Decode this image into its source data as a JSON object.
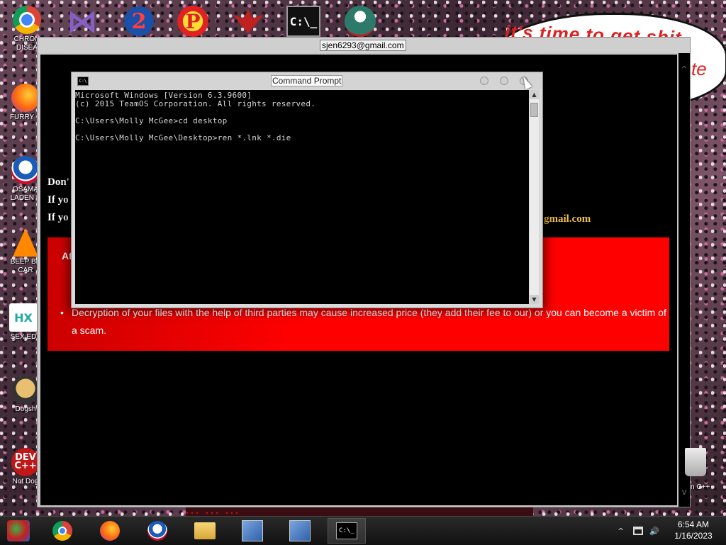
{
  "wallpaper": {
    "bubble_text": "it's time to get shit",
    "bubble_text_tail": "te",
    "bottom_text": "... ... ..."
  },
  "desktop_icons": [
    {
      "name": "chrome-icon",
      "label": "CHRON\nDISEA"
    },
    {
      "name": "firefox-icon",
      "label": "FURRY C"
    },
    {
      "name": "obama-icon",
      "label": "OSAMA\nLADEN E"
    },
    {
      "name": "vlc-cone-icon",
      "label": "BEEP BE\nCAR"
    },
    {
      "name": "hx-icon",
      "label": "SEX ED"
    },
    {
      "name": "dog-icon",
      "label": "Dogsh"
    },
    {
      "name": "devcpp-icon",
      "label": "Not Dog"
    }
  ],
  "top_icons": {
    "cmd_label": "C:\\_"
  },
  "ransom_window": {
    "title": "sjen6293@gmail.com",
    "line1": "Don'",
    "line2": "If yo",
    "line3": "If yo",
    "email_fragment": "gmail.com",
    "attention": "At",
    "bullet_text": "Decryption of your files with the help of third parties may cause increased price (they add their fee to our) or you can become a victim of a scam."
  },
  "command_prompt": {
    "title": "Command Prompt",
    "icon_text": "C:\\",
    "lines": [
      "Microsoft Windows [Version 6.3.9600]",
      "(c) 2015 TeamOS Corporation. All rights reserved.",
      "",
      "C:\\Users\\Molly McGee>cd desktop",
      "",
      "C:\\Users\\Molly McGee\\Desktop>ren *.lnk *.die"
    ]
  },
  "recycle_bin": {
    "label": "n C++"
  },
  "taskbar": {
    "cmd_button_text": "C:\\_",
    "clock_time": "6:54 AM",
    "clock_date": "1/16/2023",
    "tray_arrow": "^",
    "volume_icon": "🔊"
  }
}
